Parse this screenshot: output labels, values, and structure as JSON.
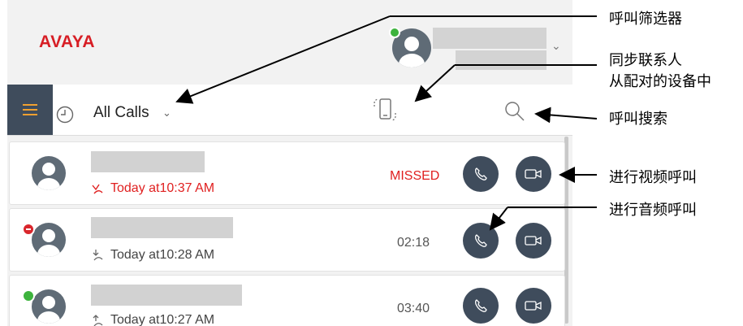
{
  "app": {
    "logo": "AVAYA"
  },
  "toolbar": {
    "filter_label": "All Calls"
  },
  "calls": [
    {
      "time": "Today at10:37 AM",
      "status": "MISSED",
      "presence": "none"
    },
    {
      "time": "Today at10:28 AM",
      "status": "02:18",
      "presence": "busy"
    },
    {
      "time": "Today at10:27 AM",
      "status": "03:40",
      "presence": "available"
    }
  ],
  "callouts": {
    "filter": "呼叫筛选器",
    "sync_line1": "同步联系人",
    "sync_line2": "从配对的设备中",
    "search": "呼叫搜索",
    "video_call": "进行视频呼叫",
    "audio_call": "进行音频呼叫"
  },
  "colors": {
    "brand": "#d71e25",
    "dark_button": "#3f4c5c",
    "menu_icon": "#f0a030",
    "missed": "#e02020",
    "available": "#3db33d",
    "busy": "#d9262c"
  },
  "icons": [
    "menu-icon",
    "clock-icon",
    "chevron-down-icon",
    "sync-phone-icon",
    "search-icon",
    "phone-icon",
    "video-icon",
    "missed-call-icon",
    "incoming-call-icon",
    "outgoing-call-icon"
  ]
}
